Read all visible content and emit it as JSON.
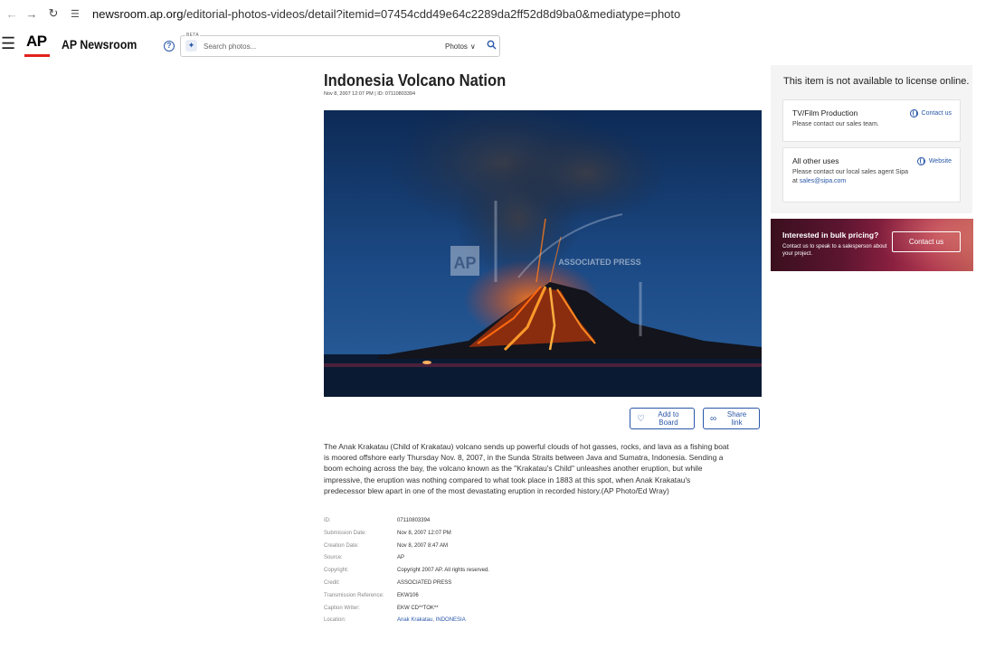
{
  "browser": {
    "url_host": "newsroom.ap.org",
    "url_path": "/editorial-photos-videos/detail?itemid=07454cdd49e64c2289da2ff52d8d9ba0&mediatype=photo"
  },
  "header": {
    "logo": "AP",
    "brand": "AP Newsroom",
    "search": {
      "beta_label": "BETA",
      "placeholder": "Search photos...",
      "filter_value": "Photos"
    }
  },
  "article": {
    "title": "Indonesia Volcano Nation",
    "meta": "Nov 8, 2007 12:07 PM  |  ID: 07110803394",
    "watermark_logo": "AP",
    "watermark_text": "ASSOCIATED PRESS",
    "add_to_board": "Add to Board",
    "share_link": "Share link",
    "caption": "The Anak Krakatau (Child of Krakatau) volcano sends up powerful clouds of hot gasses, rocks, and lava as a fishing boat is moored offshore early Thursday Nov. 8, 2007, in the Sunda Straits between Java and Sumatra, Indonesia. Sending a boom echoing across the bay, the volcano known as the \"Krakatau's Child\" unleashes another eruption, but while impressive, the eruption was nothing compared to what took place in 1883 at this spot, when Anak Krakatau's predecessor blew apart in one of the most devastating eruption in recorded history.(AP Photo/Ed Wray)",
    "details": [
      {
        "label": "ID:",
        "value": "07110803394"
      },
      {
        "label": "Submission Date:",
        "value": "Nov 8, 2007 12:07 PM"
      },
      {
        "label": "Creation Date:",
        "value": "Nov 8, 2007 8:47 AM"
      },
      {
        "label": "Source:",
        "value": "AP"
      },
      {
        "label": "Copyright:",
        "value": "Copyright 2007 AP. All rights reserved."
      },
      {
        "label": "Credit:",
        "value": "ASSOCIATED PRESS"
      },
      {
        "label": "Transmission Reference:",
        "value": "EKW106"
      },
      {
        "label": "Caption Writer:",
        "value": "EKW CD**TOK**"
      },
      {
        "label": "Location:",
        "value": "Anak Krakatau, INDONESIA"
      }
    ]
  },
  "license": {
    "title": "This item is not available to license online.",
    "tv_title": "TV/Film Production",
    "tv_text": "Please contact our sales team.",
    "tv_link": "Contact us",
    "other_title": "All other uses",
    "other_text": "Please contact our local sales agent Sipa at",
    "other_email": "sales@sipa.com",
    "other_link": "Website"
  },
  "promo": {
    "headline": "Interested in bulk pricing?",
    "text": "Contact us to speak to a salesperson about your project.",
    "button": "Contact us"
  },
  "colors": {
    "accent": "#2a57a8",
    "ap_red": "#e2211c",
    "panel_bg": "#f4f4f4"
  }
}
